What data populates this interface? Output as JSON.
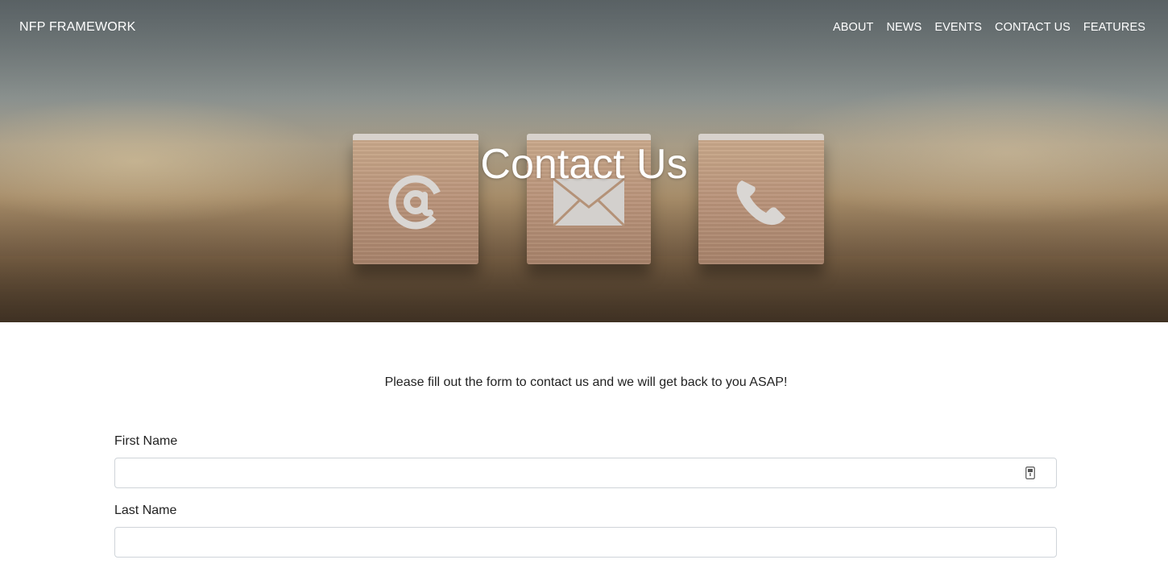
{
  "navbar": {
    "brand": "NFP FRAMEWORK",
    "links": [
      "ABOUT",
      "NEWS",
      "EVENTS",
      "CONTACT US",
      "FEATURES"
    ]
  },
  "hero": {
    "title": "Contact Us",
    "blocks": [
      {
        "icon": "at-sign-icon"
      },
      {
        "icon": "envelope-icon"
      },
      {
        "icon": "phone-icon"
      }
    ]
  },
  "form": {
    "intro": "Please fill out the form to contact us and we will get back to you ASAP!",
    "first_name_label": "First Name",
    "first_name_value": "",
    "last_name_label": "Last Name",
    "last_name_value": ""
  },
  "colors": {
    "text": "#222222",
    "input_border": "#cfd4d9",
    "nav_text": "#ffffff"
  }
}
